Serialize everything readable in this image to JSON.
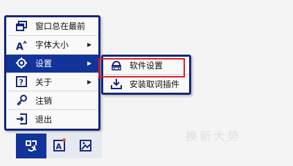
{
  "background_watermark": "换新大势",
  "menu": {
    "items": [
      {
        "label": "窗口总在最前",
        "icon": "window-stack-icon",
        "submenu": false
      },
      {
        "label": "字体大小",
        "icon": "font-size-icon",
        "submenu": true
      },
      {
        "label": "设置",
        "icon": "gear-icon",
        "submenu": true,
        "active": true
      },
      {
        "label": "关于",
        "icon": "question-icon",
        "submenu": true
      },
      {
        "label": "注销",
        "icon": "key-icon",
        "submenu": false
      },
      {
        "label": "退出",
        "icon": "exit-icon",
        "submenu": false
      }
    ],
    "arrow": "▶"
  },
  "submenu": {
    "items": [
      {
        "label": "软件设置",
        "icon": "settings-panel-icon"
      },
      {
        "label": "安装取词插件",
        "icon": "download-icon"
      }
    ]
  },
  "colors": {
    "accent": "#123399",
    "border": "#12257a",
    "highlight": "#e21a1a",
    "badge": "#e84c1a"
  },
  "toolbar": {
    "buttons": [
      {
        "icon": "app-logo-icon"
      },
      {
        "icon": "translate-card-icon",
        "badge": true
      },
      {
        "icon": "image-translate-icon"
      }
    ]
  }
}
